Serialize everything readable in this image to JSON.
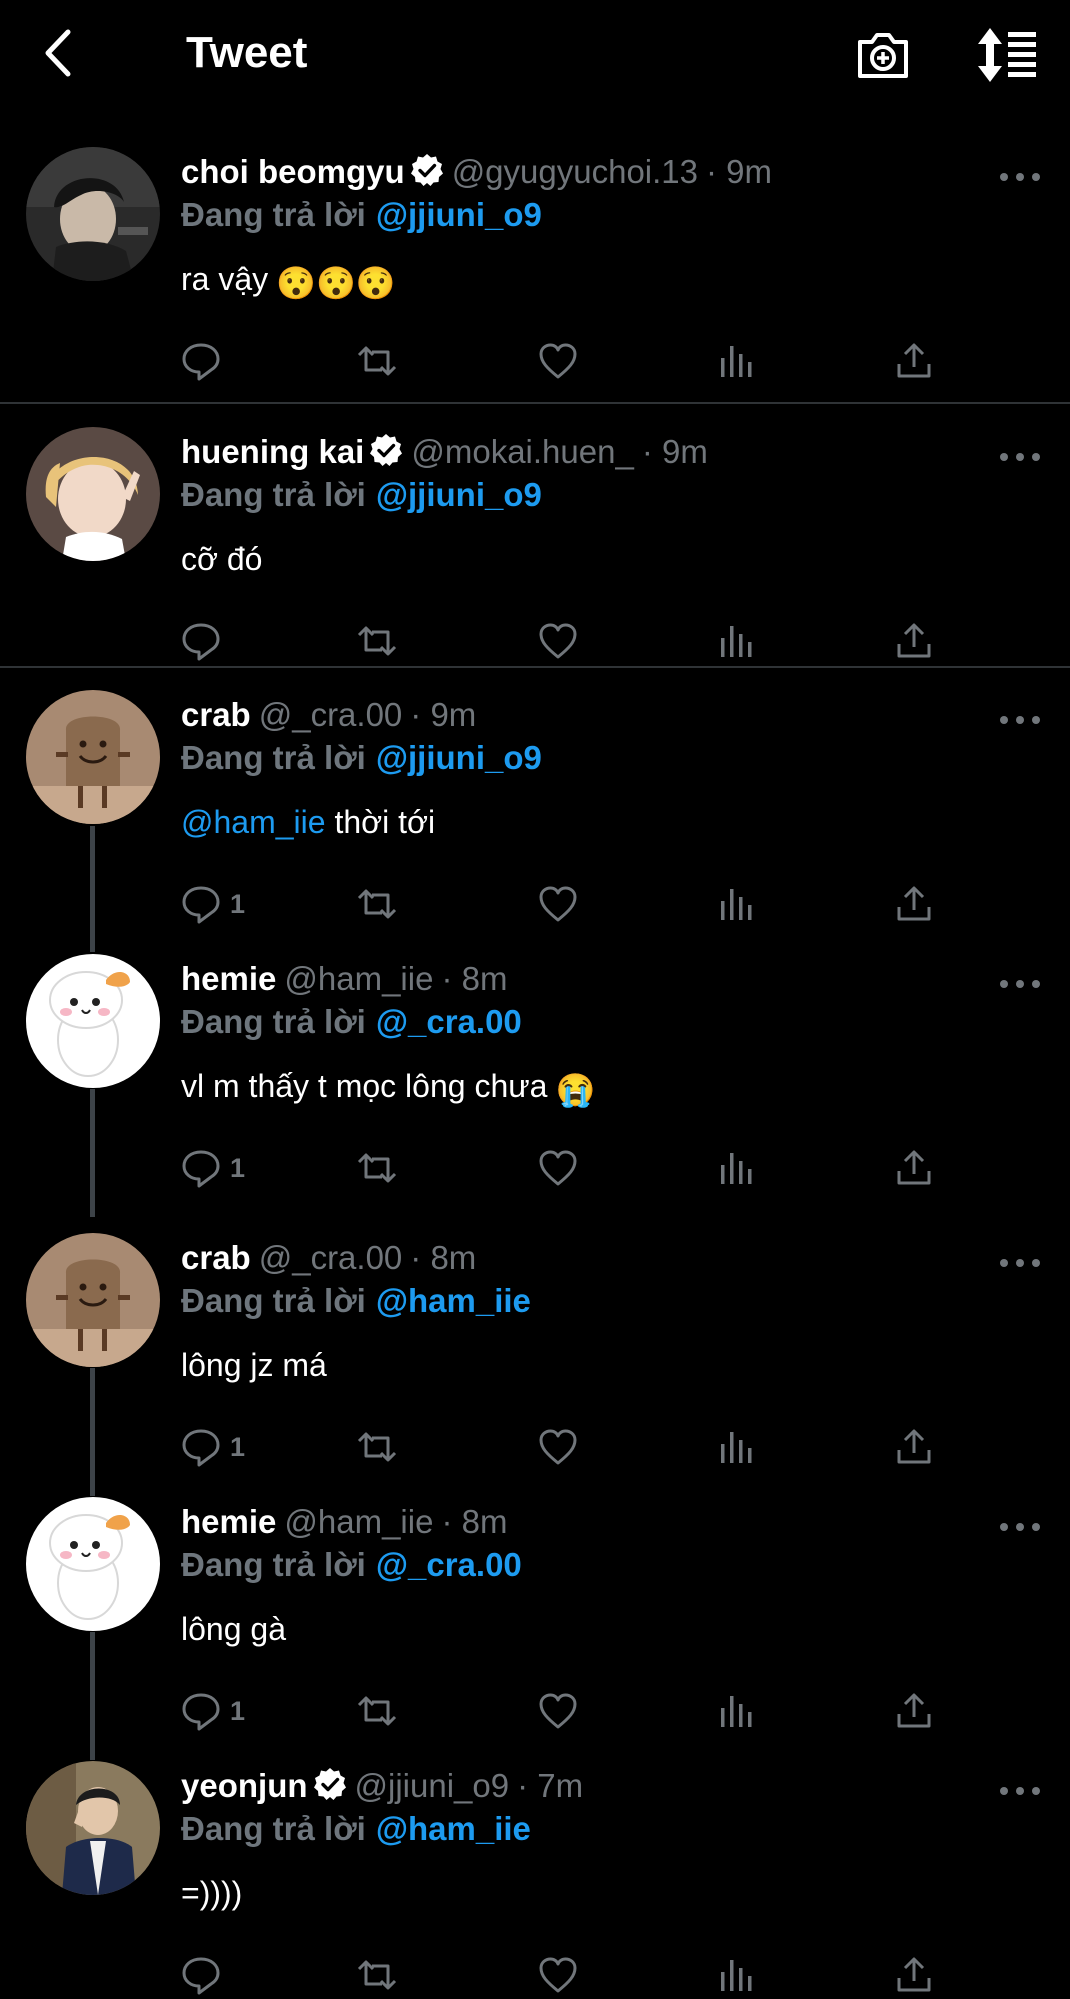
{
  "header": {
    "title": "Tweet",
    "back_icon": "chevron-left-icon",
    "camera_icon": "camera-add-icon",
    "sort_icon": "sort-list-icon"
  },
  "colors": {
    "background": "#000000",
    "link_blue": "#1d9bf0",
    "muted": "#71767b",
    "divider": "#2f3336",
    "thread_line": "#3d4348"
  },
  "reply_label": "Đang trả lời",
  "tweets": [
    {
      "name": "choi beomgyu",
      "verified": true,
      "handle": "@gyugyuchoi.13",
      "time": "· 9m",
      "reply_to": "@jjiuni_o9",
      "text": "ra vậy",
      "emoji": "😯😯😯",
      "reply_count": "",
      "avatar": "avatar-dark-hair"
    },
    {
      "name": "huening kai",
      "verified": true,
      "handle": "@mokai.huen_",
      "time": "· 9m",
      "reply_to": "@jjiuni_o9",
      "text": "cỡ đó",
      "reply_count": "",
      "avatar": "avatar-blonde"
    },
    {
      "name": "crab",
      "verified": false,
      "handle": "@_cra.00",
      "time": "· 9m",
      "reply_to": "@jjiuni_o9",
      "mention": "@ham_iie",
      "text": "thời tới",
      "reply_count": "1",
      "avatar": "avatar-toast"
    },
    {
      "name": "hemie",
      "verified": false,
      "handle": "@ham_iie",
      "time": "· 8m",
      "reply_to": "@_cra.00",
      "text": "vl m thấy t mọc lông chưa",
      "emoji": "😭",
      "reply_count": "1",
      "avatar": "avatar-hamster"
    },
    {
      "name": "crab",
      "verified": false,
      "handle": "@_cra.00",
      "time": "· 8m",
      "reply_to": "@ham_iie",
      "text": "lông jz má",
      "reply_count": "1",
      "avatar": "avatar-toast"
    },
    {
      "name": "hemie",
      "verified": false,
      "handle": "@ham_iie",
      "time": "· 8m",
      "reply_to": "@_cra.00",
      "text": "lông gà",
      "reply_count": "1",
      "avatar": "avatar-hamster"
    },
    {
      "name": "yeonjun",
      "verified": true,
      "handle": "@jjiuni_o9",
      "time": "· 7m",
      "reply_to": "@ham_iie",
      "text": "=))))",
      "reply_count": "",
      "avatar": "avatar-boy-blue-jacket"
    }
  ]
}
